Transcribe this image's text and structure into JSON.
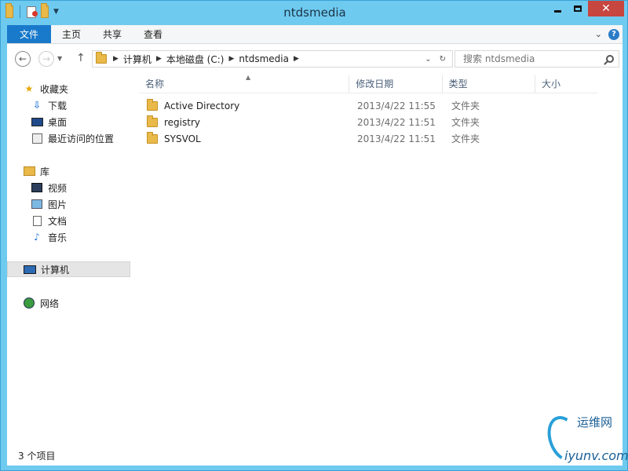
{
  "window": {
    "title": "ntdsmedia",
    "controls": {
      "minimize": "—",
      "maximize": "□",
      "close": "✕"
    }
  },
  "ribbon": {
    "tabs": [
      {
        "label": "文件"
      },
      {
        "label": "主页"
      },
      {
        "label": "共享"
      },
      {
        "label": "查看"
      }
    ],
    "help": "?"
  },
  "address": {
    "crumbs": [
      "计算机",
      "本地磁盘 (C:)",
      "ntdsmedia"
    ],
    "search_placeholder": "搜索 ntdsmedia"
  },
  "nav": {
    "favorites": {
      "label": "收藏夹",
      "items": [
        "下载",
        "桌面",
        "最近访问的位置"
      ]
    },
    "libraries": {
      "label": "库",
      "items": [
        "视频",
        "图片",
        "文档",
        "音乐"
      ]
    },
    "computer": {
      "label": "计算机"
    },
    "network": {
      "label": "网络"
    }
  },
  "filelist": {
    "columns": [
      "名称",
      "修改日期",
      "类型",
      "大小"
    ],
    "rows": [
      {
        "name": "Active Directory",
        "date": "2013/4/22 11:55",
        "type": "文件夹"
      },
      {
        "name": "registry",
        "date": "2013/4/22 11:51",
        "type": "文件夹"
      },
      {
        "name": "SYSVOL",
        "date": "2013/4/22 11:51",
        "type": "文件夹"
      }
    ]
  },
  "status": {
    "item_count": "3 个项目"
  },
  "watermark": {
    "top": "运维网",
    "bottom": "iyunv.com"
  },
  "colors": {
    "titlebar": "#6fcaf0",
    "file_tab": "#1979ca",
    "close_button": "#c7463f",
    "folder": "#e9b949"
  }
}
